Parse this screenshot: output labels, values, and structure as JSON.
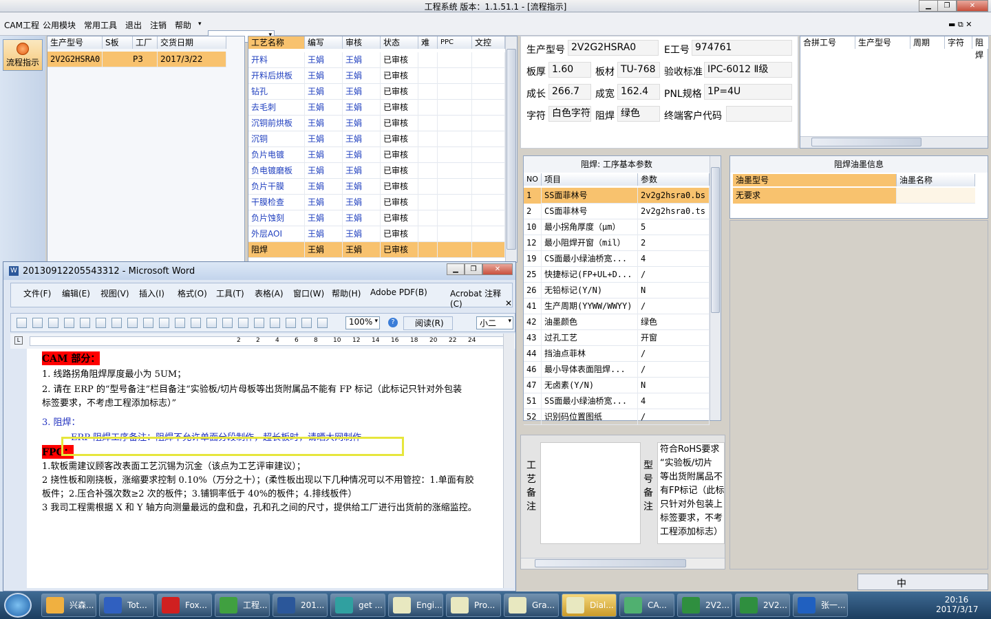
{
  "window": {
    "title": "工程系统   版本：1.1.51.1 - [流程指示]",
    "inner_ctrl": "▬ ⧉ ✕"
  },
  "menu": {
    "items": [
      "CAM工程",
      "公用模块",
      "常用工具",
      "退出",
      "注销",
      "帮助"
    ],
    "dropdown_arrow": "▾"
  },
  "nav": {
    "button_label": "流程指示"
  },
  "orders": {
    "headers": [
      "生产型号",
      "S板",
      "工厂",
      "交货日期"
    ],
    "rows": [
      [
        "2V2G2HSRA0",
        "",
        "P3",
        "2017/3/22"
      ]
    ]
  },
  "process": {
    "headers": [
      "工艺名称",
      "编写",
      "审核",
      "状态",
      "难",
      "PPC",
      "文控"
    ],
    "rows": [
      [
        "开料",
        "王娟",
        "王娟",
        "已审核"
      ],
      [
        "开料后烘板",
        "王娟",
        "王娟",
        "已审核"
      ],
      [
        "钻孔",
        "王娟",
        "王娟",
        "已审核"
      ],
      [
        "去毛刺",
        "王娟",
        "王娟",
        "已审核"
      ],
      [
        "沉铜前烘板",
        "王娟",
        "王娟",
        "已审核"
      ],
      [
        "沉铜",
        "王娟",
        "王娟",
        "已审核"
      ],
      [
        "负片电镀",
        "王娟",
        "王娟",
        "已审核"
      ],
      [
        "负电镀磨板",
        "王娟",
        "王娟",
        "已审核"
      ],
      [
        "负片干膜",
        "王娟",
        "王娟",
        "已审核"
      ],
      [
        "干膜检查",
        "王娟",
        "王娟",
        "已审核"
      ],
      [
        "负片蚀刻",
        "王娟",
        "王娟",
        "已审核"
      ],
      [
        "外层AOI",
        "王娟",
        "王娟",
        "已审核"
      ],
      [
        "阻焊",
        "王娟",
        "王娟",
        "已审核"
      ]
    ],
    "selected_index": 12
  },
  "info": {
    "prod_model_label": "生产型号",
    "prod_model": "2V2G2HSRA0",
    "e_no_label": "E工号",
    "e_no": "974761",
    "thickness_label": "板厚",
    "thickness": "1.60",
    "material_label": "板材",
    "material": "TU-768",
    "standard_label": "验收标准",
    "standard": "IPC-6012 Ⅱ级",
    "length_label": "成长",
    "length": "266.7",
    "width_label": "成宽",
    "width": "162.4",
    "pnl_label": "PNL规格",
    "pnl": "1P=4U",
    "char_label": "字符",
    "char": "白色字符",
    "mask_label": "阻焊",
    "mask": "绿色",
    "customer_label": "终端客户代码",
    "customer": ""
  },
  "merge": {
    "headers": [
      "合拼工号",
      "生产型号",
      "周期",
      "字符",
      "阻焊"
    ]
  },
  "params": {
    "title": "阻焊: 工序基本参数",
    "headers": [
      "NO",
      "项目",
      "参数"
    ],
    "rows": [
      [
        "1",
        "SS面菲林号",
        "2v2g2hsra0.bs"
      ],
      [
        "2",
        "CS面菲林号",
        "2v2g2hsra0.ts"
      ],
      [
        "10",
        "最小拐角厚度（μm）",
        "5"
      ],
      [
        "12",
        "最小阻焊开窗（mil）",
        "2"
      ],
      [
        "19",
        "CS面最小绿油桥宽...",
        "4"
      ],
      [
        "25",
        "快捷标记(FP+UL+D...",
        "/"
      ],
      [
        "26",
        "无铅标记(Y/N)",
        "N"
      ],
      [
        "41",
        "生产周期(YYWW/WWYY)",
        "/"
      ],
      [
        "42",
        "油墨颜色",
        "绿色"
      ],
      [
        "43",
        "过孔工艺",
        "开窗"
      ],
      [
        "44",
        "挡油点菲林",
        "/"
      ],
      [
        "46",
        "最小导体表面阻焊...",
        "/"
      ],
      [
        "47",
        "无卤素(Y/N)",
        "N"
      ],
      [
        "51",
        "SS面最小绿油桥宽...",
        "4"
      ],
      [
        "52",
        "识别码位置图纸",
        "/"
      ]
    ]
  },
  "ink": {
    "title": "阻焊油墨信息",
    "headers": [
      "油墨型号",
      "油墨名称"
    ],
    "rows": [
      [
        "无要求",
        ""
      ]
    ]
  },
  "remarks": {
    "process_label": "工艺备注",
    "model_label": "型号备注",
    "model_text": "符合RoHS要求\n“实验板/切片\n等出货附属品不\n有FP标记（此标\n只针对外包装上\n标签要求，不考\n工程添加标志）"
  },
  "word": {
    "title": "20130912205543312 - Microsoft Word",
    "menu": [
      "文件(F)",
      "编辑(E)",
      "视图(V)",
      "插入(I)",
      "格式(O)",
      "工具(T)",
      "表格(A)",
      "窗口(W)",
      "帮助(H)",
      "Adobe PDF(B)",
      "Acrobat 注释(C)"
    ],
    "zoom": "100%",
    "read_btn": "阅读(R)",
    "font_size": "小二",
    "ruler": [
      "2",
      "2",
      "4",
      "6",
      "8",
      "10",
      "12",
      "14",
      "16",
      "18",
      "20",
      "22",
      "24"
    ],
    "lines": [
      "CAM 部分：",
      "1.   线路拐角阻焊厚度最小为 5UM；",
      "2. 请在 ERP 的“型号备注”栏目备注“实验板/切片母板等出货附属品不能有 FP 标记（此标记只针对外包装",
      "标签要求，不考虑工程添加标志）”",
      "3. 阻焊：",
      "ERP 阻焊工序备注：阻焊不允许单面分段制作，超长板时，请晒大网制作",
      "FPC：",
      "1.软板需建议顾客改表面工艺沉锡为沉金（该点为工艺评审建议）；",
      "2 挠性板和刚挠板，涨缩要求控制 0.10%（万分之十）；(柔性板出现以下几种情况可以不用管控：1.单面有胶",
      "板件；2.压合补强次数≥2 次的板件；3.铺铜率低于 40%的板件；4.排线板件）",
      "3 我司工程需根据 X 和 Y 轴方向测量最远的盘和盘，孔和孔之间的尺寸，提供给工厂进行出货前的涨缩监控。"
    ]
  },
  "taskbar": {
    "tasks": [
      "兴森...",
      "Tot...",
      "Fox...",
      "工程...",
      "201...",
      "get ...",
      "Engi...",
      "Pro...",
      "Gra...",
      "Dial...",
      "CA...",
      "2V2...",
      "2V2...",
      "张一..."
    ],
    "time": "20:16",
    "date": "2017/3/17",
    "ime": "中"
  }
}
